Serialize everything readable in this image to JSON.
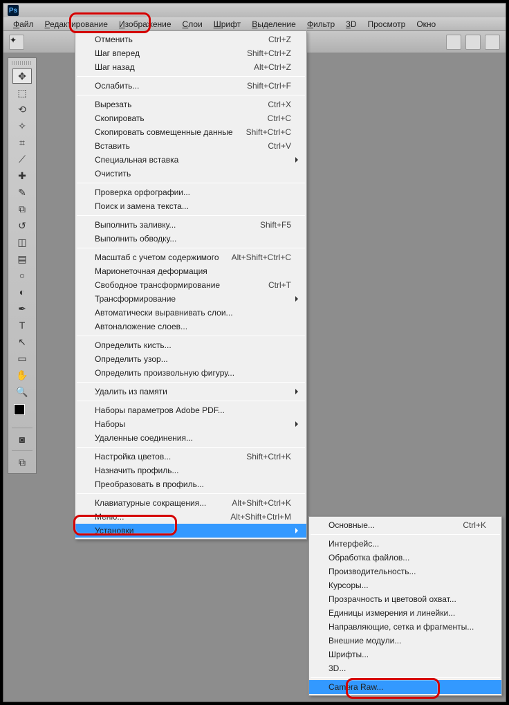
{
  "menubar": [
    "Файл",
    "Редактирование",
    "Изображение",
    "Слои",
    "Шрифт",
    "Выделение",
    "Фильтр",
    "3D",
    "Просмотр",
    "Окно"
  ],
  "tools": [
    "move",
    "marquee",
    "lasso",
    "wand",
    "crop",
    "eyedrop",
    "heal",
    "brush",
    "stamp",
    "history",
    "eraser",
    "gradient",
    "blur",
    "dodge",
    "pen",
    "type",
    "path",
    "rect",
    "hand",
    "zoom"
  ],
  "menu": [
    [
      {
        "l": "Отменить",
        "s": "Ctrl+Z",
        "d": 1
      },
      {
        "l": "Шаг вперед",
        "s": "Shift+Ctrl+Z"
      },
      {
        "l": "Шаг назад",
        "s": "Alt+Ctrl+Z"
      }
    ],
    [
      {
        "l": "Ослабить...",
        "s": "Shift+Ctrl+F",
        "d": 1
      }
    ],
    [
      {
        "l": "Вырезать",
        "s": "Ctrl+X",
        "d": 1
      },
      {
        "l": "Скопировать",
        "s": "Ctrl+C",
        "d": 1
      },
      {
        "l": "Скопировать совмещенные данные",
        "s": "Shift+Ctrl+C",
        "d": 1
      },
      {
        "l": "Вставить",
        "s": "Ctrl+V",
        "d": 1
      },
      {
        "l": "Специальная вставка",
        "a": 1,
        "d": 1
      },
      {
        "l": "Очистить",
        "d": 1
      }
    ],
    [
      {
        "l": "Проверка орфографии...",
        "d": 1
      },
      {
        "l": "Поиск и замена текста...",
        "d": 1
      }
    ],
    [
      {
        "l": "Выполнить заливку...",
        "s": "Shift+F5"
      },
      {
        "l": "Выполнить обводку...",
        "d": 1
      }
    ],
    [
      {
        "l": "Масштаб с учетом содержимого",
        "s": "Alt+Shift+Ctrl+C",
        "d": 1
      },
      {
        "l": "Марионеточная деформация",
        "d": 1
      },
      {
        "l": "Свободное трансформирование",
        "s": "Ctrl+T",
        "d": 1
      },
      {
        "l": "Трансформирование",
        "a": 1,
        "d": 1
      },
      {
        "l": "Автоматически выравнивать слои...",
        "d": 1
      },
      {
        "l": "Автоналожение слоев...",
        "d": 1
      }
    ],
    [
      {
        "l": "Определить кисть...",
        "d": 1
      },
      {
        "l": "Определить узор...",
        "d": 1
      },
      {
        "l": "Определить произвольную фигуру...",
        "d": 1
      }
    ],
    [
      {
        "l": "Удалить из памяти",
        "a": 1
      }
    ],
    [
      {
        "l": "Наборы параметров Adobe PDF..."
      },
      {
        "l": "Наборы",
        "a": 1
      },
      {
        "l": "Удаленные соединения..."
      }
    ],
    [
      {
        "l": "Настройка цветов...",
        "s": "Shift+Ctrl+K"
      },
      {
        "l": "Назначить профиль...",
        "d": 1
      },
      {
        "l": "Преобразовать в профиль...",
        "d": 1
      }
    ],
    [
      {
        "l": "Клавиатурные сокращения...",
        "s": "Alt+Shift+Ctrl+K"
      },
      {
        "l": "Меню...",
        "s": "Alt+Shift+Ctrl+M"
      },
      {
        "l": "Установки",
        "a": 1,
        "sel": 1
      }
    ]
  ],
  "submenu": [
    [
      {
        "l": "Основные...",
        "s": "Ctrl+K"
      }
    ],
    [
      {
        "l": "Интерфейс..."
      },
      {
        "l": "Обработка файлов..."
      },
      {
        "l": "Производительность..."
      },
      {
        "l": "Курсоры..."
      },
      {
        "l": "Прозрачность и цветовой охват..."
      },
      {
        "l": "Единицы измерения и линейки..."
      },
      {
        "l": "Направляющие, сетка и фрагменты..."
      },
      {
        "l": "Внешние модули..."
      },
      {
        "l": "Шрифты..."
      },
      {
        "l": "3D..."
      }
    ],
    [
      {
        "l": "Camera Raw...",
        "sel": 1
      }
    ]
  ]
}
